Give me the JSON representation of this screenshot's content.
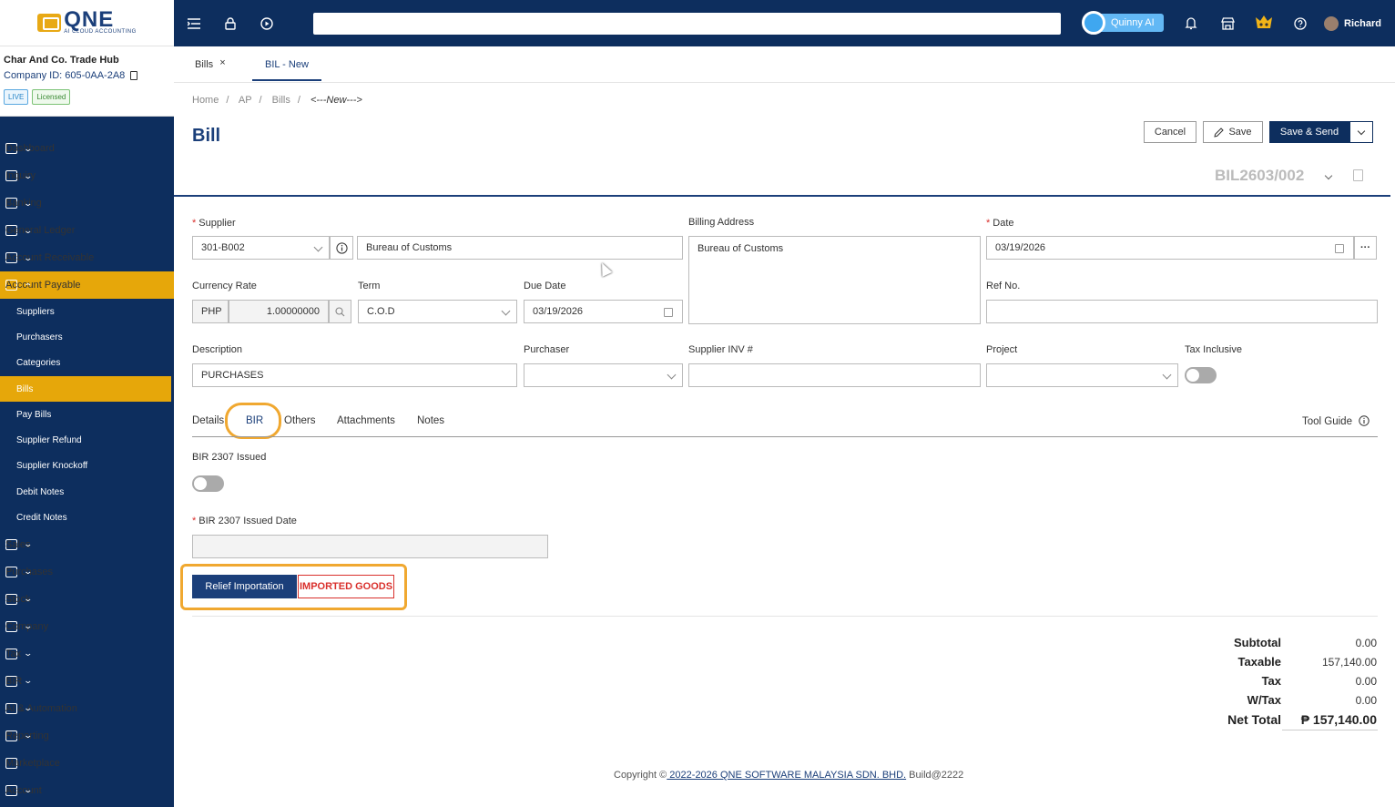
{
  "brand": {
    "logo_text": "QNE",
    "logo_sub": "AI CLOUD ACCOUNTING"
  },
  "company": {
    "name": "Char And Co. Trade Hub",
    "id_label": "Company ID: 605-0AA-2A8",
    "badge_live": "LIVE",
    "badge_licensed": "Licensed"
  },
  "nav": [
    {
      "label": "Dashboard",
      "icon": "dashboard-icon"
    },
    {
      "label": "Inquiry",
      "icon": "inquiry-icon"
    },
    {
      "label": "Banking",
      "icon": "bank-icon"
    },
    {
      "label": "General Ledger",
      "icon": "ledger-icon"
    },
    {
      "label": "Account Receivable",
      "icon": "receivable-icon"
    },
    {
      "label": "Account Payable",
      "icon": "payable-icon",
      "active": true
    }
  ],
  "subnav": [
    "Suppliers",
    "Purchasers",
    "Categories",
    "Bills",
    "Pay Bills",
    "Supplier Refund",
    "Supplier Knockoff",
    "Debit Notes",
    "Credit Notes"
  ],
  "subnav_active": "Bills",
  "nav2": [
    {
      "label": "Sales"
    },
    {
      "label": "Purchases"
    },
    {
      "label": "Stock"
    },
    {
      "label": "Company"
    },
    {
      "label": "Tax"
    },
    {
      "label": "BIR"
    },
    {
      "label": "AI & Automation"
    },
    {
      "label": "Reporting"
    },
    {
      "label": "Marketplace"
    },
    {
      "label": "Account"
    }
  ],
  "topbar": {
    "quinny": "Quinny AI",
    "user": "Richard"
  },
  "tabs": {
    "bills": "Bills",
    "close": "×",
    "new": "BIL - New"
  },
  "breadcrumb": {
    "home": "Home",
    "ap": "AP",
    "bills": "Bills",
    "current": "<---New--->",
    "sep": "/"
  },
  "page_title": "Bill",
  "buttons": {
    "cancel": "Cancel",
    "save": "Save",
    "save_send": "Save & Send"
  },
  "doc_no": "BIL2603/002",
  "form": {
    "supplier_label": "Supplier",
    "supplier_code": "301-B002",
    "supplier_name": "Bureau of Customs",
    "billing_label": "Billing Address",
    "billing_value": "Bureau of Customs",
    "date_label": "Date",
    "date_value": "03/19/2026",
    "currency_label": "Currency Rate",
    "currency": "PHP",
    "rate": "1.00000000",
    "term_label": "Term",
    "term_value": "C.O.D",
    "due_label": "Due Date",
    "due_value": "03/19/2026",
    "ref_label": "Ref No.",
    "ref_value": "",
    "desc_label": "Description",
    "desc_value": "PURCHASES",
    "purchaser_label": "Purchaser",
    "purchaser_value": "",
    "inv_label": "Supplier INV #",
    "inv_value": "",
    "project_label": "Project",
    "project_value": "",
    "tax_incl_label": "Tax Inclusive"
  },
  "detail_tabs": {
    "details": "Details",
    "bir": "BIR",
    "others": "Others",
    "attachments": "Attachments",
    "notes": "Notes",
    "tool_guide": "Tool Guide"
  },
  "bir": {
    "issued_label": "BIR 2307 Issued",
    "issued_date_label": "BIR 2307 Issued Date",
    "issued_date_value": "",
    "relief": "Relief Importation",
    "imported": "IMPORTED GOODS"
  },
  "totals": {
    "subtotal_label": "Subtotal",
    "subtotal": "0.00",
    "taxable_label": "Taxable",
    "taxable": "157,140.00",
    "tax_label": "Tax",
    "tax": "0.00",
    "wtax_label": "W/Tax",
    "wtax": "0.00",
    "net_label": "Net Total",
    "net": "₱ 157,140.00"
  },
  "footer": {
    "copyright": "Copyright ©",
    "link": " 2022-2026 QNE SOFTWARE MALAYSIA SDN. BHD.",
    "build": " Build@2222"
  },
  "colors": {
    "navy": "#0d2e5e",
    "accent": "#e6a70a",
    "required": "#d9302c",
    "highlight": "#f0a830"
  }
}
